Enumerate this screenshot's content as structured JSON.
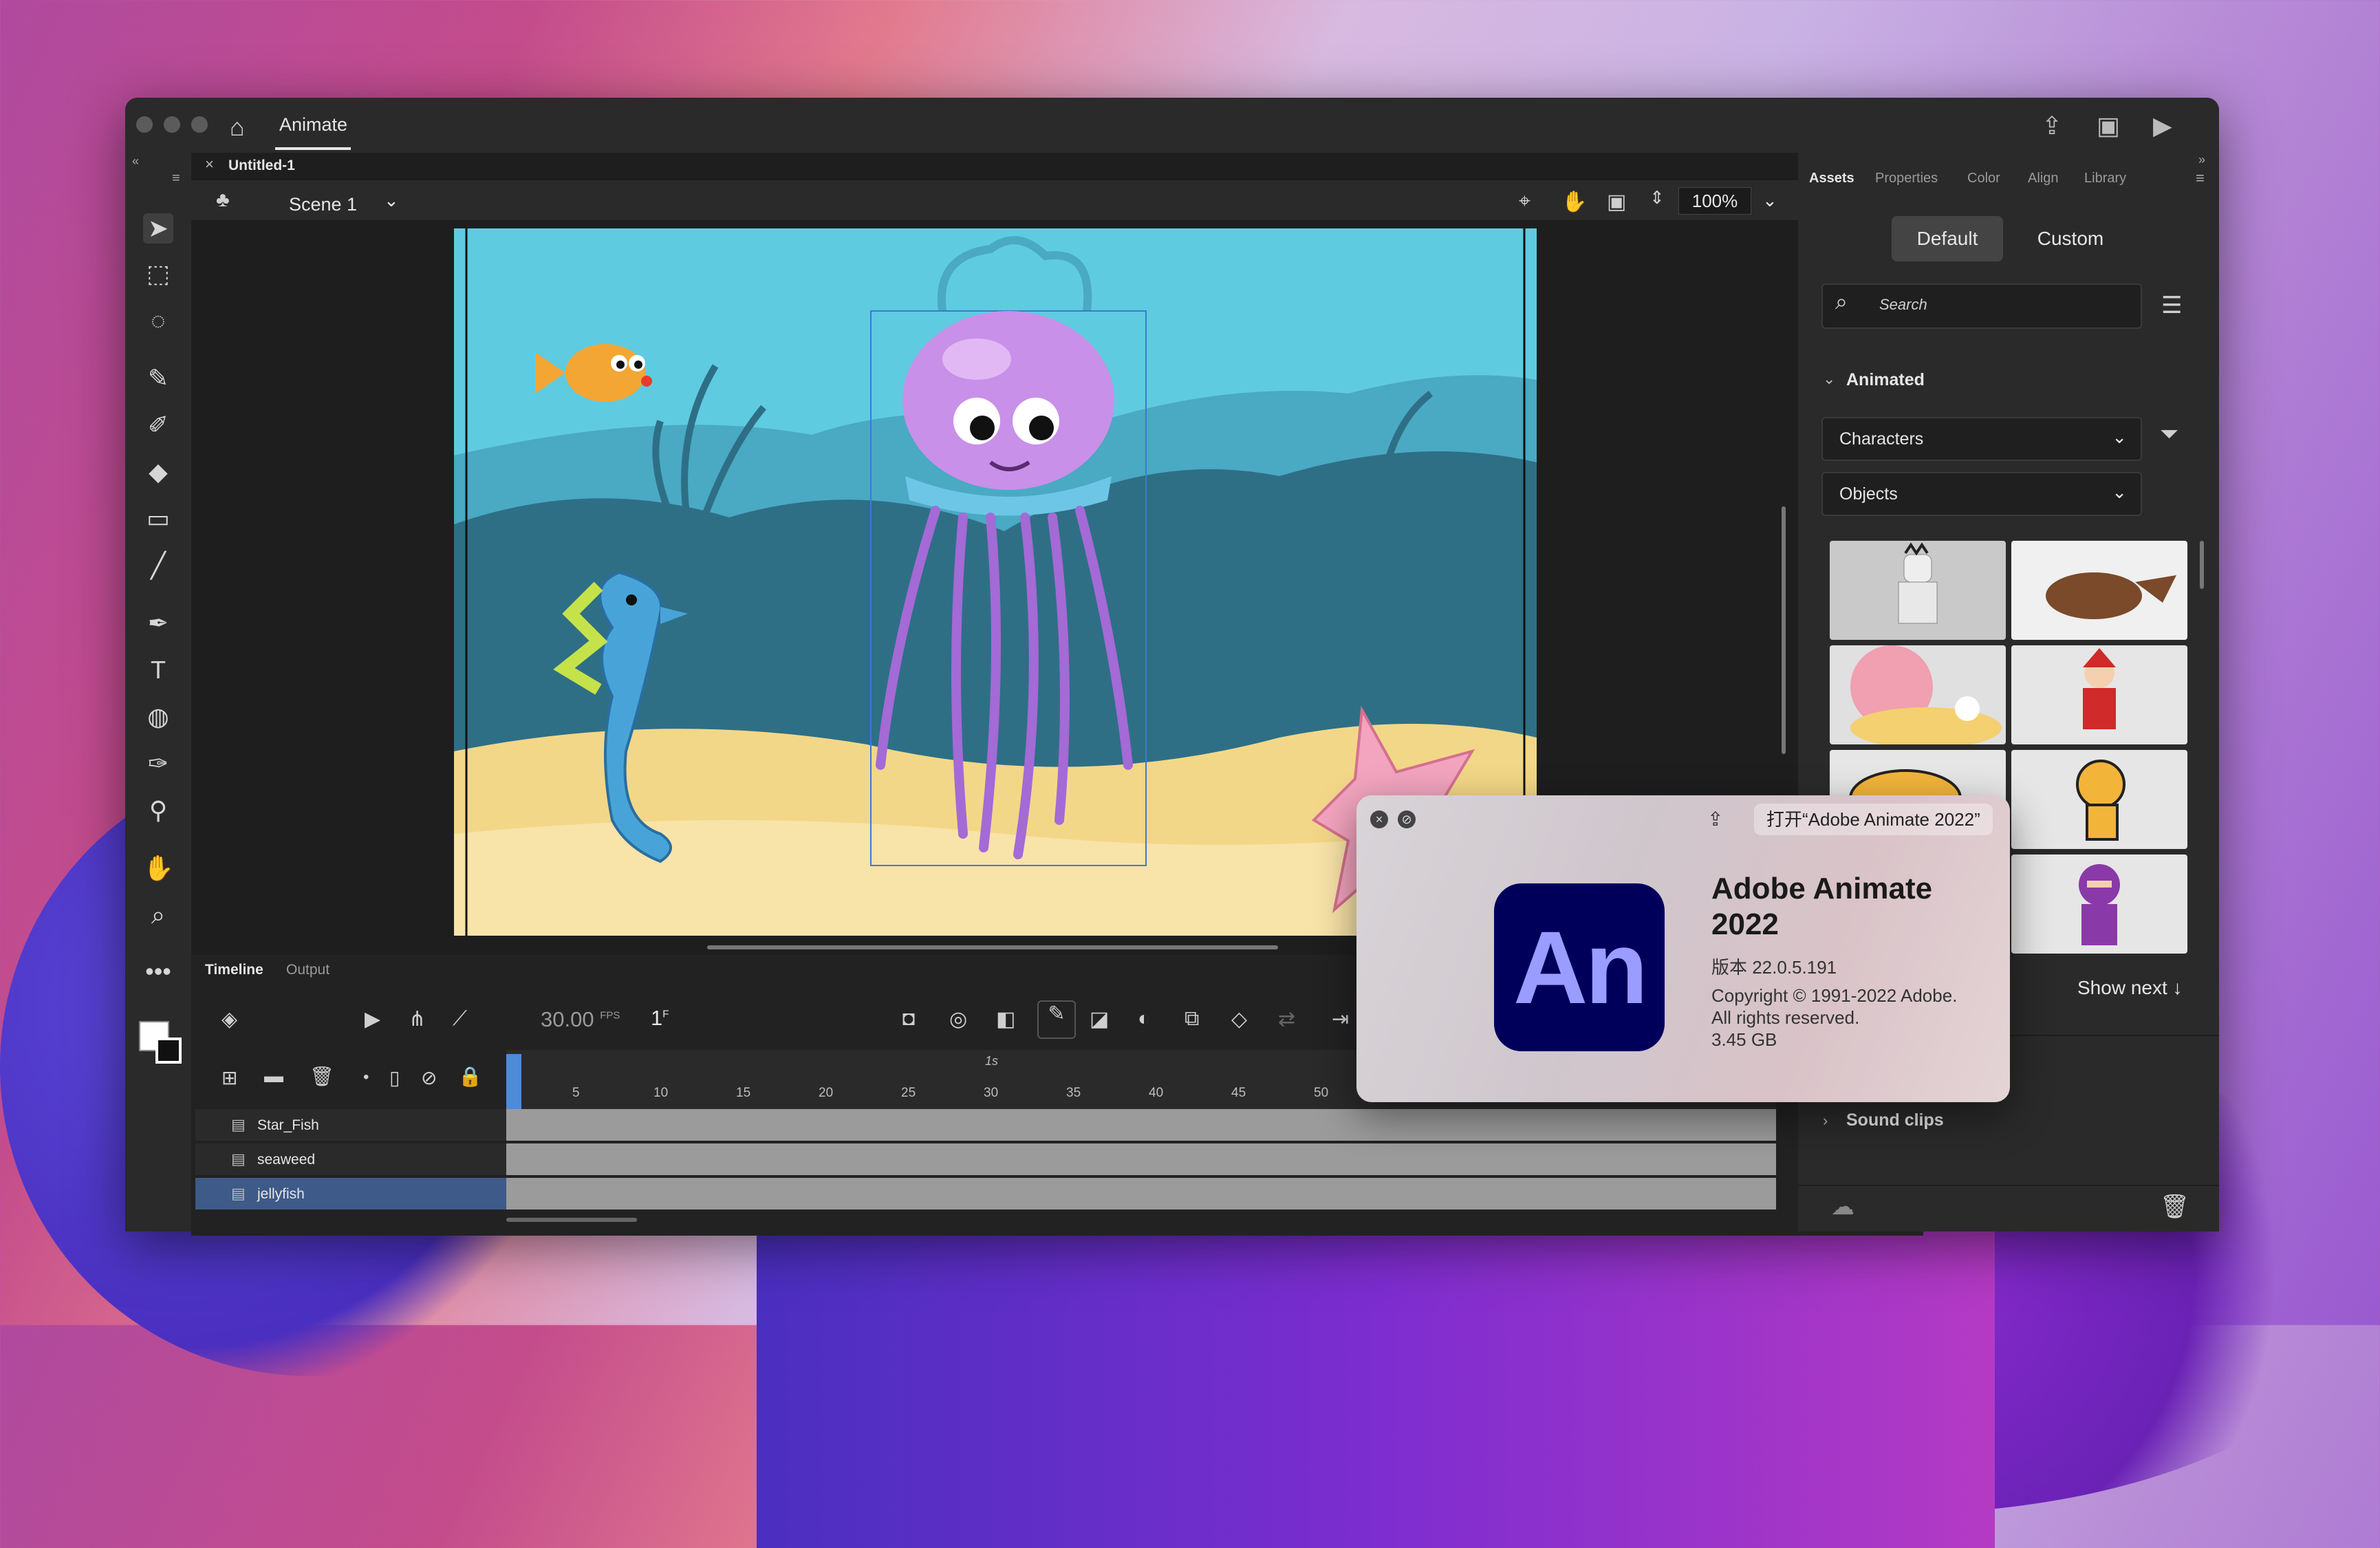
{
  "window": {
    "app_tab": "Animate",
    "document_tab": "Untitled-1"
  },
  "stage_bar": {
    "scene": "Scene 1",
    "zoom": "100%"
  },
  "timeline": {
    "tabs": [
      "Timeline",
      "Output"
    ],
    "fps": "30.00",
    "fps_unit": "FPS",
    "frame": "1",
    "frame_unit": "F",
    "ruler_second": "1s",
    "ticks": [
      "5",
      "10",
      "15",
      "20",
      "25",
      "30",
      "35",
      "40",
      "45",
      "50"
    ],
    "layers": [
      {
        "name": "Star_Fish",
        "color": "#4fd6e8",
        "locked": true,
        "selected": false
      },
      {
        "name": "seaweed",
        "color": "#f08a2c",
        "locked": true,
        "selected": false
      },
      {
        "name": "jellyfish",
        "color": "#4fd6e8",
        "locked": false,
        "selected": true
      }
    ]
  },
  "panel": {
    "tabs": [
      "Assets",
      "Properties",
      "Color",
      "Align",
      "Library"
    ],
    "active_tab": "Assets",
    "segment": [
      "Default",
      "Custom"
    ],
    "search_placeholder": "Search",
    "animated_section": "Animated",
    "dropdowns": [
      "Characters",
      "Objects"
    ],
    "show_next": "Show next ↓",
    "sound_clips": "Sound clips"
  },
  "about": {
    "open_button": "打开“Adobe Animate 2022”",
    "logo_text": "An",
    "app_name": "Adobe Animate 2022",
    "version": "版本 22.0.5.191",
    "copyright": "Copyright © 1991-2022 Adobe.",
    "rights": "All rights reserved.",
    "size": "3.45 GB"
  },
  "colors": {
    "accent": "#4d8bd8",
    "an_logo_bg": "#00005b",
    "an_logo_text": "#9a9cff"
  }
}
